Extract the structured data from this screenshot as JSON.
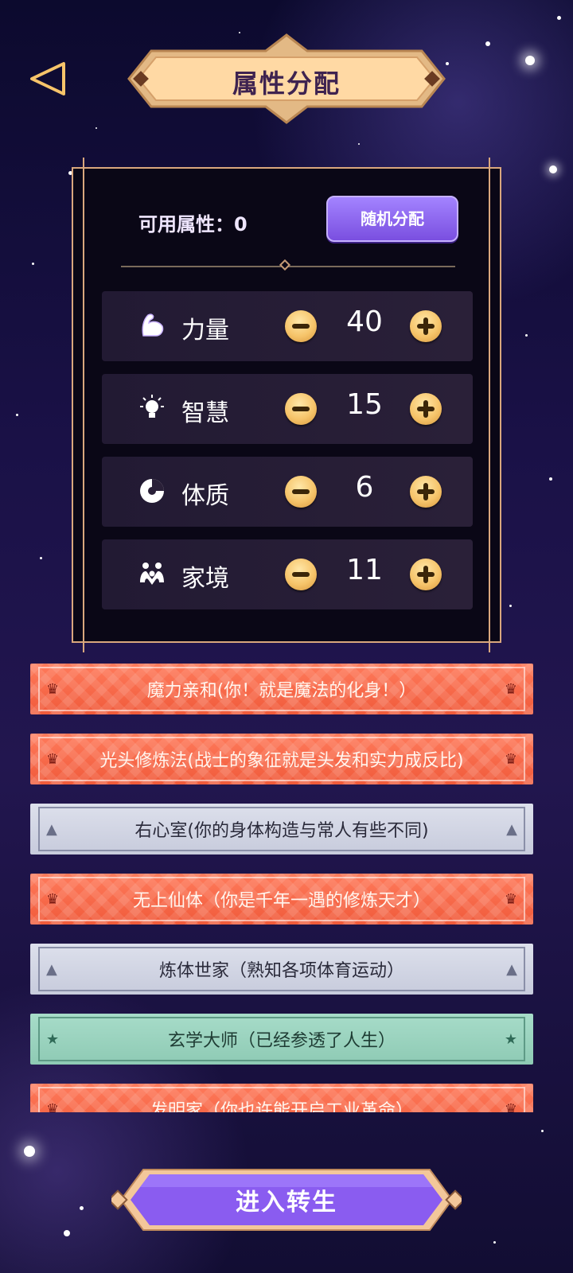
{
  "header": {
    "title": "属性分配"
  },
  "panel": {
    "available_label": "可用属性：0",
    "random_button": "随机分配",
    "attributes": [
      {
        "icon": "muscle-icon",
        "label": "力量",
        "value": "40"
      },
      {
        "icon": "lightbulb-icon",
        "label": "智慧",
        "value": "15"
      },
      {
        "icon": "pie-chart-icon",
        "label": "体质",
        "value": "6"
      },
      {
        "icon": "family-icon",
        "label": "家境",
        "value": "11"
      }
    ]
  },
  "talents": [
    {
      "text": "魔力亲和(你！就是魔法的化身！）",
      "rarity": "orange",
      "icon": "crown-icon"
    },
    {
      "text": "光头修炼法(战士的象征就是头发和实力成反比)",
      "rarity": "orange",
      "icon": "crown-icon"
    },
    {
      "text": "右心室(你的身体构造与常人有些不同)",
      "rarity": "grey",
      "icon": "triangle-icon"
    },
    {
      "text": "无上仙体（你是千年一遇的修炼天才）",
      "rarity": "orange",
      "icon": "crown-icon"
    },
    {
      "text": "炼体世家（熟知各项体育运动）",
      "rarity": "grey",
      "icon": "triangle-icon"
    },
    {
      "text": "玄学大师（已经参透了人生）",
      "rarity": "green",
      "icon": "star-icon"
    },
    {
      "text": "发明家（你也许能开启工业革命）",
      "rarity": "orange",
      "icon": "crown-icon"
    }
  ],
  "footer": {
    "enter_button": "进入转生"
  },
  "colors": {
    "gold": "#f6c46a",
    "purple_button": "#8a5cf0",
    "talent_orange": "#f26444",
    "talent_grey": "#d2d5e4",
    "talent_green": "#9fd6c2"
  }
}
